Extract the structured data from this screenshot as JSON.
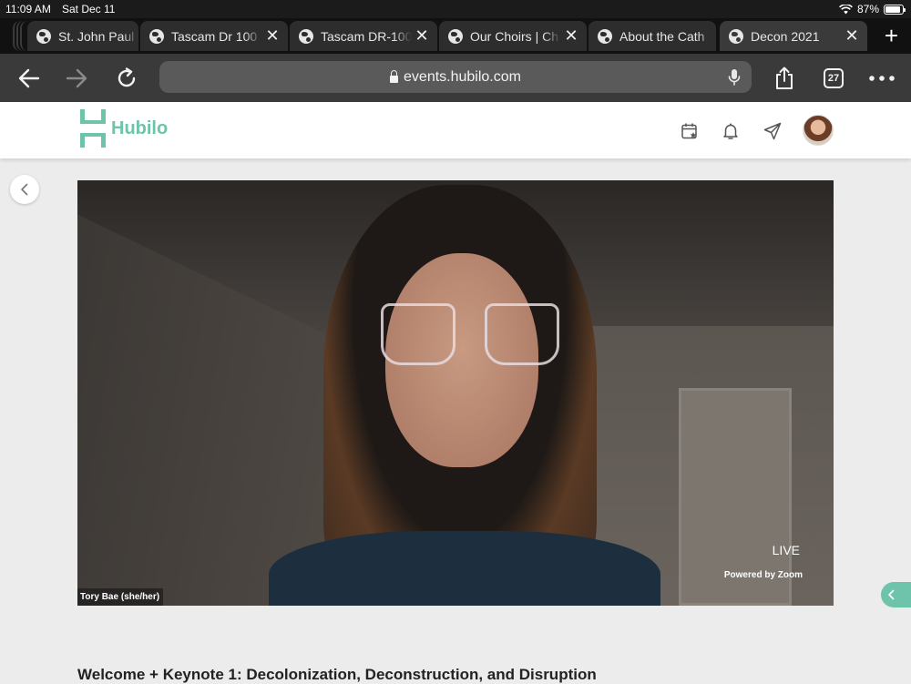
{
  "status_bar": {
    "time": "11:09 AM",
    "date": "Sat Dec 11",
    "battery": "87%",
    "battery_level": 0.87
  },
  "tabs": [
    {
      "title": "St. John Paul",
      "active": false,
      "has_close": false
    },
    {
      "title": "Tascam Dr 100",
      "active": false,
      "has_close": true
    },
    {
      "title": "Tascam DR-100",
      "active": false,
      "has_close": true
    },
    {
      "title": "Our Choirs | Ch",
      "active": false,
      "has_close": true
    },
    {
      "title": "About the Cath",
      "active": false,
      "has_close": false
    },
    {
      "title": "Decon 2021",
      "active": true,
      "has_close": true
    }
  ],
  "tab_close_glyph": "✕",
  "new_tab_glyph": "+",
  "toolbar": {
    "url": "events.hubilo.com",
    "tab_count": "27"
  },
  "site": {
    "brand": "Hubilo",
    "accent": "#6dc4ab"
  },
  "video": {
    "live_label": "LIVE",
    "powered_by": "Powered by Zoom",
    "speaker_name": "Tory Bae (she/her)"
  },
  "session": {
    "title": "Welcome + Keynote 1: Decolonization, Deconstruction, and Disruption"
  },
  "icons": [
    "wifi-icon",
    "battery-icon",
    "globe-icon",
    "close-icon",
    "back-arrow-icon",
    "forward-arrow-icon",
    "reload-icon",
    "lock-icon",
    "microphone-icon",
    "share-icon",
    "more-icon",
    "calendar-icon",
    "bell-icon",
    "send-icon",
    "chevron-left-icon"
  ]
}
